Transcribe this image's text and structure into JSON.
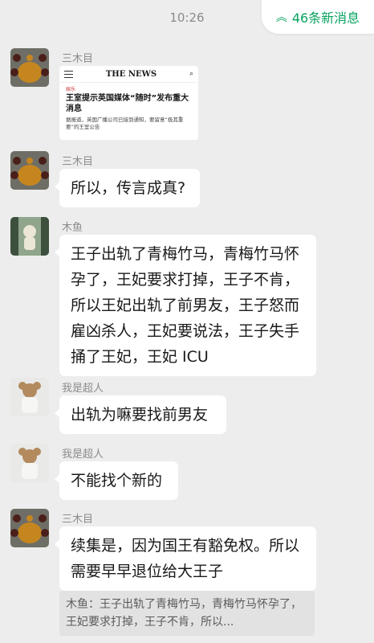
{
  "status": {
    "time": "10:26"
  },
  "new_messages": {
    "label": "46条新消息"
  },
  "messages": [
    {
      "sender": "三木目",
      "card": {
        "brand": "THE NEWS",
        "category": "娱乐",
        "headline": "王室提示英国媒体“随时”发布重大消息",
        "summary": "据报道，英国广播公司已接到通知，要留意“极其重要”的王室公告"
      }
    },
    {
      "sender": "三木目",
      "text": "所以，传言成真?"
    },
    {
      "sender": "木鱼",
      "text": "王子出轨了青梅竹马，青梅竹马怀孕了，王妃要求打掉，王子不肯，所以王妃出轨了前男友，王子怒而雇凶杀人，王妃要说法，王子失手捅了王妃，王妃 ICU"
    },
    {
      "sender": "我是超人",
      "text": "出轨为嘛要找前男友"
    },
    {
      "sender": "我是超人",
      "text": "不能找个新的"
    },
    {
      "sender": "三木目",
      "text": "续集是，因为国王有豁免权。所以需要早早退位给大王子",
      "quote": "木鱼：王子出轨了青梅竹马，青梅竹马怀孕了，王妃要求打掉，王子不肯，所以..."
    }
  ]
}
